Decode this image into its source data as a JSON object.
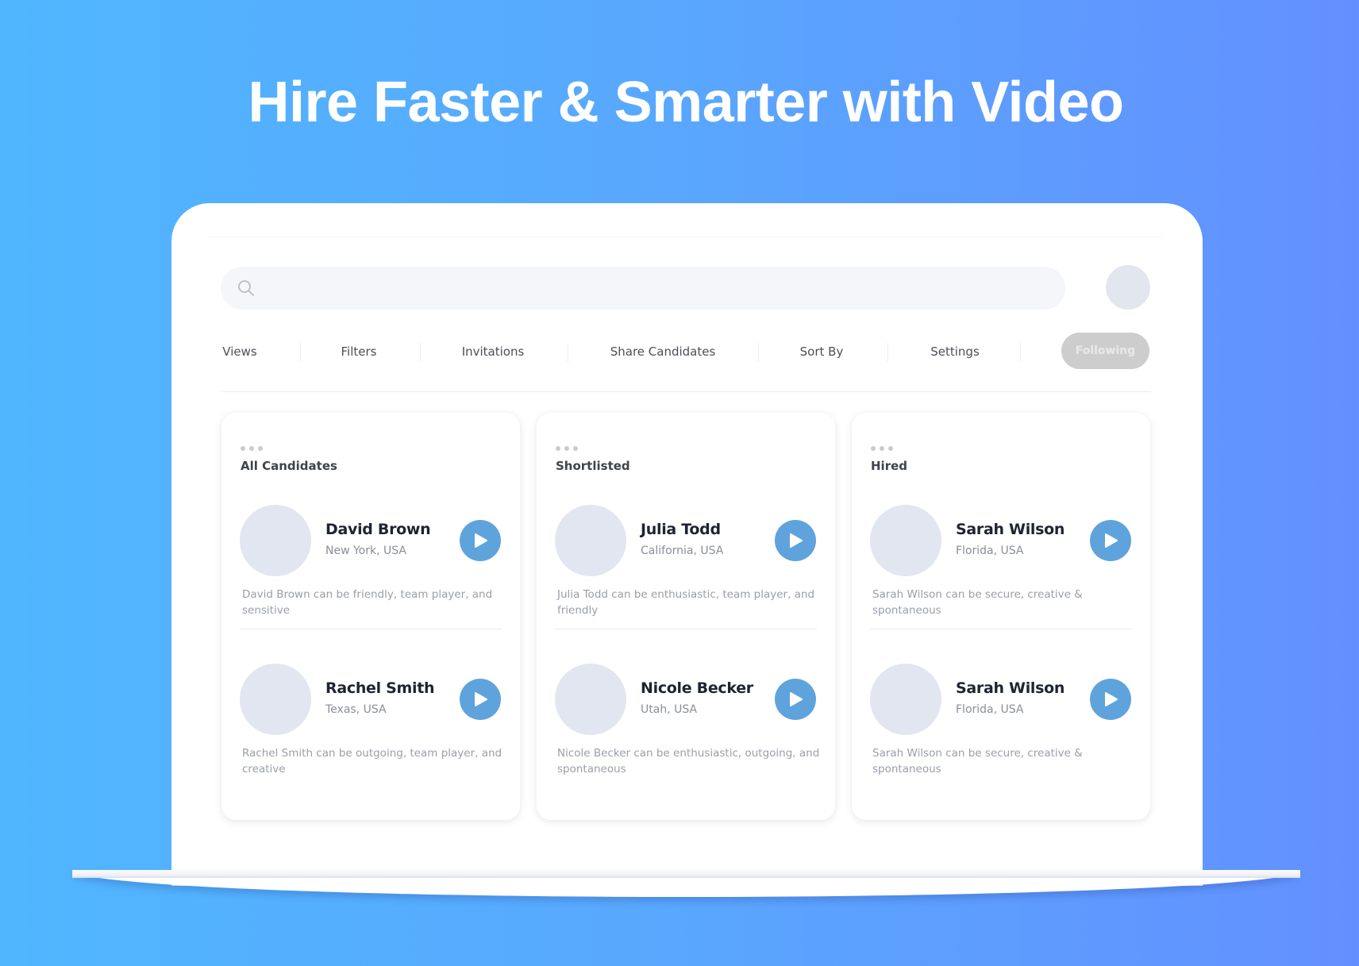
{
  "headline": "Hire Faster & Smarter with Video",
  "colors": {
    "background_start": "#50b6fe",
    "background_end": "#6390ff",
    "accent_play": "#5fa3dc",
    "following_button": "#cdcdcd"
  },
  "search": {
    "icon": "search-icon",
    "value": "",
    "placeholder": ""
  },
  "user_avatar": "avatar-placeholder",
  "nav": {
    "items": [
      {
        "label": "Views"
      },
      {
        "label": "Filters"
      },
      {
        "label": "Invitations"
      },
      {
        "label": "Share Candidates"
      },
      {
        "label": "Sort By"
      },
      {
        "label": "Settings"
      }
    ],
    "following_label": "Following"
  },
  "columns": [
    {
      "title": "All Candidates",
      "menu_icon": "more-dots-icon",
      "candidates": [
        {
          "name": "David Brown",
          "location": "New York, USA",
          "description": "David Brown can be friendly, team player, and sensitive"
        },
        {
          "name": "Rachel Smith",
          "location": "Texas, USA",
          "description": "Rachel Smith can be outgoing, team player, and creative"
        }
      ]
    },
    {
      "title": "Shortlisted",
      "menu_icon": "more-dots-icon",
      "candidates": [
        {
          "name": "Julia Todd",
          "location": "California, USA",
          "description": "Julia Todd can be enthusiastic, team player, and friendly"
        },
        {
          "name": "Nicole Becker",
          "location": "Utah, USA",
          "description": "Nicole Becker can be enthusiastic, outgoing, and spontaneous"
        }
      ]
    },
    {
      "title": "Hired",
      "menu_icon": "more-dots-icon",
      "candidates": [
        {
          "name": "Sarah Wilson",
          "location": "Florida, USA",
          "description": "Sarah Wilson can be secure, creative & spontaneous"
        },
        {
          "name": "Sarah Wilson",
          "location": "Florida, USA",
          "description": "Sarah Wilson can be secure, creative & spontaneous"
        }
      ]
    }
  ]
}
